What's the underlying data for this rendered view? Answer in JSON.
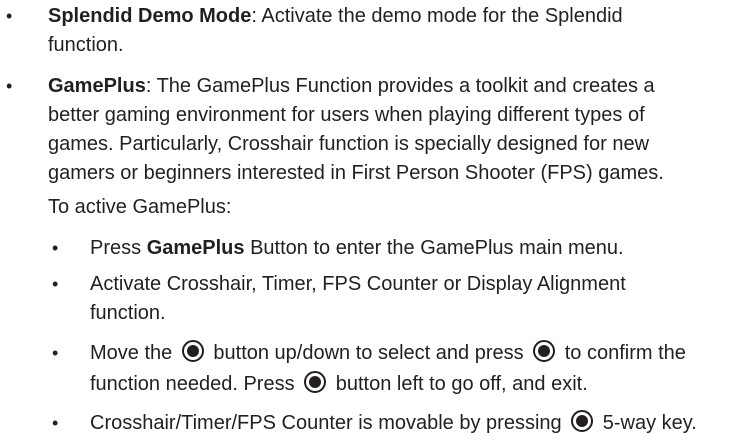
{
  "bullets": {
    "symbol": "•"
  },
  "splendid": {
    "title": "Splendid Demo Mode",
    "line1": ": Activate the demo mode for the Splendid",
    "line2": "function."
  },
  "gameplus": {
    "title": "GamePlus",
    "line1": ": The GamePlus Function provides a toolkit and creates a",
    "line2": "better gaming environment for users when playing different types of",
    "line3": "games. Particularly, Crosshair function is specially designed for new",
    "line4": "gamers or beginners interested in First Person Shooter (FPS) games.",
    "intro": "To active GamePlus:",
    "steps": {
      "s1_pre": "Press ",
      "s1_bold": "GamePlus",
      "s1_post": " Button to enter the GamePlus main menu.",
      "s2_line1": "Activate Crosshair, Timer, FPS Counter or Display Alignment",
      "s2_line2": "function.",
      "s3_a": "Move the",
      "s3_b": "button up/down to select and press",
      "s3_c": "to confirm the",
      "s3_line2_a": "function needed. Press",
      "s3_line2_b": "button left to go off, and exit.",
      "s4_a": "Crosshair/Timer/FPS Counter is movable by pressing",
      "s4_b": "5-way key."
    }
  },
  "icons": {
    "key": "five-way-key-icon"
  }
}
